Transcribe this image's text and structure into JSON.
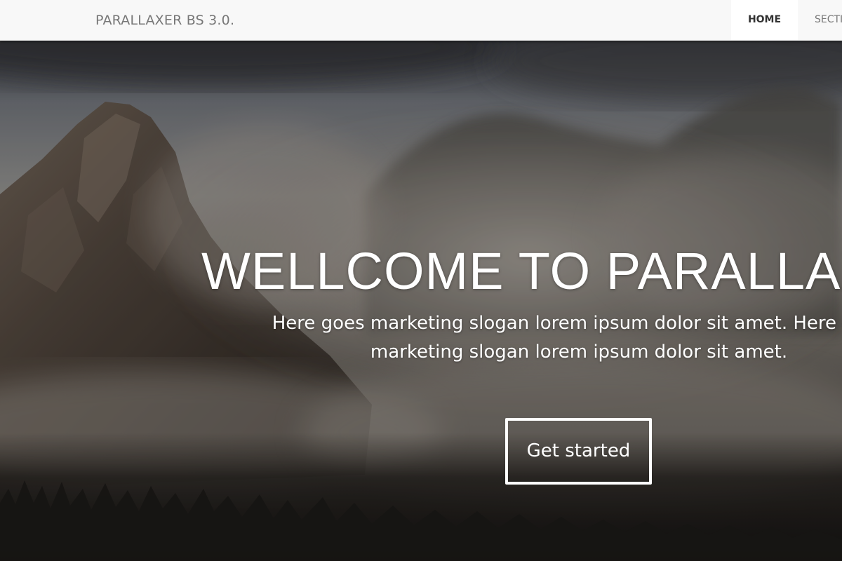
{
  "navbar": {
    "brand": "PARALLAXER BS 3.0.",
    "items": [
      {
        "label": "HOME",
        "active": true
      },
      {
        "label": "SECTION",
        "active": false
      }
    ]
  },
  "hero": {
    "title": "WELLCOME TO PARALLAXER",
    "slogan": "Here goes marketing slogan lorem ipsum dolor sit amet. Here goes marketing slogan lorem ipsum dolor sit amet.",
    "cta_label": "Get started"
  },
  "colors": {
    "navbar_bg": "#f8f8f8",
    "brand_text": "#777777",
    "active_nav_bg": "#ffffff",
    "active_nav_text": "#333333",
    "hero_text": "#ffffff"
  },
  "icons": {
    "hero_background": "misty-mountain-photo"
  }
}
